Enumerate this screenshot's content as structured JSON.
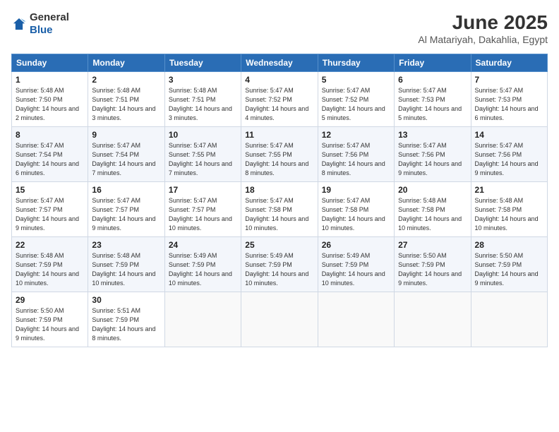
{
  "logo": {
    "general": "General",
    "blue": "Blue"
  },
  "title": "June 2025",
  "subtitle": "Al Matariyah, Dakahlia, Egypt",
  "headers": [
    "Sunday",
    "Monday",
    "Tuesday",
    "Wednesday",
    "Thursday",
    "Friday",
    "Saturday"
  ],
  "weeks": [
    [
      {
        "day": "1",
        "sunrise": "5:48 AM",
        "sunset": "7:50 PM",
        "daylight": "14 hours and 2 minutes."
      },
      {
        "day": "2",
        "sunrise": "5:48 AM",
        "sunset": "7:51 PM",
        "daylight": "14 hours and 3 minutes."
      },
      {
        "day": "3",
        "sunrise": "5:48 AM",
        "sunset": "7:51 PM",
        "daylight": "14 hours and 3 minutes."
      },
      {
        "day": "4",
        "sunrise": "5:47 AM",
        "sunset": "7:52 PM",
        "daylight": "14 hours and 4 minutes."
      },
      {
        "day": "5",
        "sunrise": "5:47 AM",
        "sunset": "7:52 PM",
        "daylight": "14 hours and 5 minutes."
      },
      {
        "day": "6",
        "sunrise": "5:47 AM",
        "sunset": "7:53 PM",
        "daylight": "14 hours and 5 minutes."
      },
      {
        "day": "7",
        "sunrise": "5:47 AM",
        "sunset": "7:53 PM",
        "daylight": "14 hours and 6 minutes."
      }
    ],
    [
      {
        "day": "8",
        "sunrise": "5:47 AM",
        "sunset": "7:54 PM",
        "daylight": "14 hours and 6 minutes."
      },
      {
        "day": "9",
        "sunrise": "5:47 AM",
        "sunset": "7:54 PM",
        "daylight": "14 hours and 7 minutes."
      },
      {
        "day": "10",
        "sunrise": "5:47 AM",
        "sunset": "7:55 PM",
        "daylight": "14 hours and 7 minutes."
      },
      {
        "day": "11",
        "sunrise": "5:47 AM",
        "sunset": "7:55 PM",
        "daylight": "14 hours and 8 minutes."
      },
      {
        "day": "12",
        "sunrise": "5:47 AM",
        "sunset": "7:56 PM",
        "daylight": "14 hours and 8 minutes."
      },
      {
        "day": "13",
        "sunrise": "5:47 AM",
        "sunset": "7:56 PM",
        "daylight": "14 hours and 9 minutes."
      },
      {
        "day": "14",
        "sunrise": "5:47 AM",
        "sunset": "7:56 PM",
        "daylight": "14 hours and 9 minutes."
      }
    ],
    [
      {
        "day": "15",
        "sunrise": "5:47 AM",
        "sunset": "7:57 PM",
        "daylight": "14 hours and 9 minutes."
      },
      {
        "day": "16",
        "sunrise": "5:47 AM",
        "sunset": "7:57 PM",
        "daylight": "14 hours and 9 minutes."
      },
      {
        "day": "17",
        "sunrise": "5:47 AM",
        "sunset": "7:57 PM",
        "daylight": "14 hours and 10 minutes."
      },
      {
        "day": "18",
        "sunrise": "5:47 AM",
        "sunset": "7:58 PM",
        "daylight": "14 hours and 10 minutes."
      },
      {
        "day": "19",
        "sunrise": "5:47 AM",
        "sunset": "7:58 PM",
        "daylight": "14 hours and 10 minutes."
      },
      {
        "day": "20",
        "sunrise": "5:48 AM",
        "sunset": "7:58 PM",
        "daylight": "14 hours and 10 minutes."
      },
      {
        "day": "21",
        "sunrise": "5:48 AM",
        "sunset": "7:58 PM",
        "daylight": "14 hours and 10 minutes."
      }
    ],
    [
      {
        "day": "22",
        "sunrise": "5:48 AM",
        "sunset": "7:59 PM",
        "daylight": "14 hours and 10 minutes."
      },
      {
        "day": "23",
        "sunrise": "5:48 AM",
        "sunset": "7:59 PM",
        "daylight": "14 hours and 10 minutes."
      },
      {
        "day": "24",
        "sunrise": "5:49 AM",
        "sunset": "7:59 PM",
        "daylight": "14 hours and 10 minutes."
      },
      {
        "day": "25",
        "sunrise": "5:49 AM",
        "sunset": "7:59 PM",
        "daylight": "14 hours and 10 minutes."
      },
      {
        "day": "26",
        "sunrise": "5:49 AM",
        "sunset": "7:59 PM",
        "daylight": "14 hours and 10 minutes."
      },
      {
        "day": "27",
        "sunrise": "5:50 AM",
        "sunset": "7:59 PM",
        "daylight": "14 hours and 9 minutes."
      },
      {
        "day": "28",
        "sunrise": "5:50 AM",
        "sunset": "7:59 PM",
        "daylight": "14 hours and 9 minutes."
      }
    ],
    [
      {
        "day": "29",
        "sunrise": "5:50 AM",
        "sunset": "7:59 PM",
        "daylight": "14 hours and 9 minutes."
      },
      {
        "day": "30",
        "sunrise": "5:51 AM",
        "sunset": "7:59 PM",
        "daylight": "14 hours and 8 minutes."
      },
      null,
      null,
      null,
      null,
      null
    ]
  ]
}
